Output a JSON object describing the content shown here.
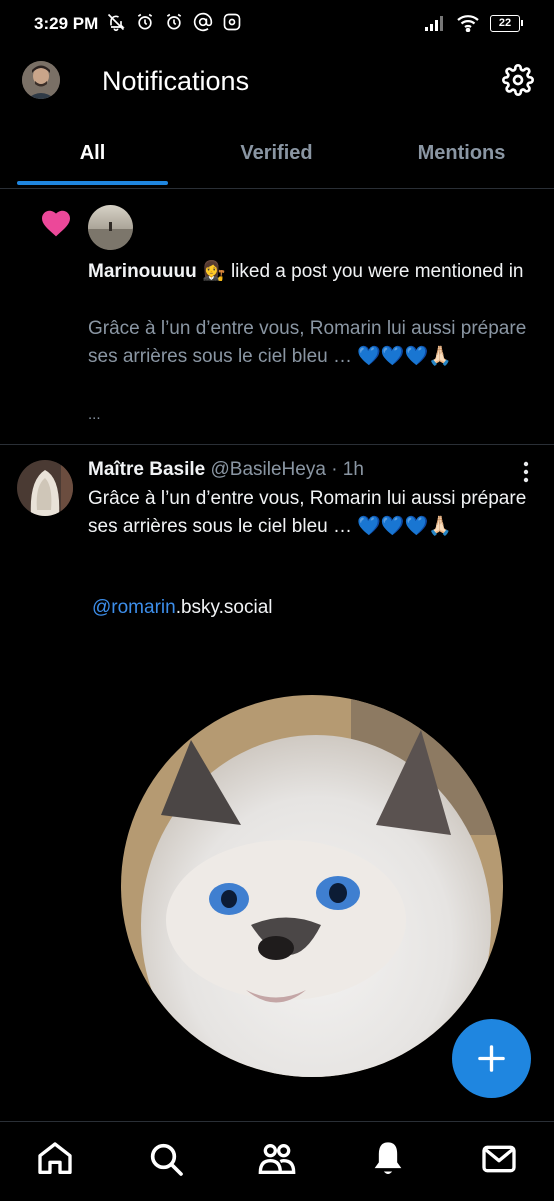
{
  "status_bar": {
    "time": "3:29 PM",
    "icons": [
      "muted-bell-icon",
      "alarm-icon",
      "alarm-icon",
      "at-icon",
      "app-icon"
    ],
    "battery": "22"
  },
  "header": {
    "title": "Notifications"
  },
  "tabs": [
    {
      "label": "All",
      "active": true
    },
    {
      "label": "Verified",
      "active": false
    },
    {
      "label": "Mentions",
      "active": false
    }
  ],
  "notifications": [
    {
      "type": "like",
      "user": "Marinouuuu",
      "emoji": "👩‍⚖️",
      "action": "liked a post you were mentioned in",
      "quote": "Grâce à l’un d’entre vous, Romarin lui aussi prépare ses arrières sous le ciel bleu … 💙💙💙🙏🏻",
      "more": "..."
    }
  ],
  "post": {
    "name": "Maître Basile",
    "handle": "@BasileHeya",
    "time": "· 1h",
    "body": "Grâce à l’un d’entre vous, Romarin lui aussi prépare ses arrières sous le ciel bleu … 💙💙💙🙏🏻",
    "mention_link": "@romarin",
    "mention_suffix": ".bsky.social"
  },
  "colors": {
    "accent": "#1f86e0",
    "link": "#3d8eea",
    "heart": "#ec4899",
    "muted_text": "#8a96a3",
    "divider": "#2a2f36",
    "background": "#000000"
  },
  "bottom_nav": [
    "home-icon",
    "search-icon",
    "people-icon",
    "bell-icon",
    "mail-icon"
  ]
}
